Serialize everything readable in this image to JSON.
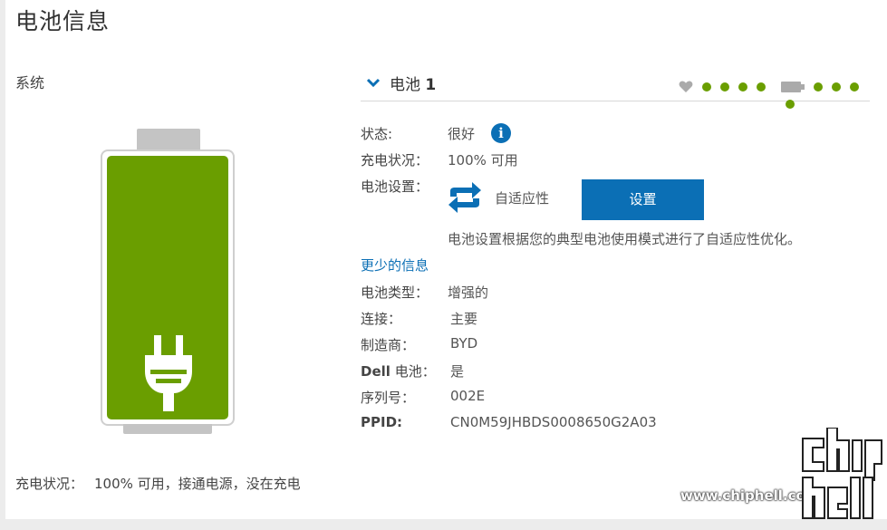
{
  "page": {
    "title": "电池信息"
  },
  "system": {
    "label": "系统"
  },
  "footer": {
    "charge_label": "充电状况：",
    "charge_value": "100% 可用，接通电源，没在充电"
  },
  "battery": {
    "name": "电池",
    "number": "1",
    "health_dots": 4,
    "charge_dots": 4,
    "accent": "#6a9e00"
  },
  "details": {
    "status_label": "状态:",
    "status_value": "很好",
    "charge_label": "充电状况：",
    "charge_value": "100% 可用",
    "setting_label": "电池设置：",
    "setting_mode": "自适应性",
    "setting_button": "设置",
    "setting_desc": "电池设置根据您的典型电池使用模式进行了自适应性优化。",
    "less_info": "更少的信息",
    "type_label": "电池类型：",
    "type_value": "增强的",
    "connect_label": "连接：",
    "connect_value": "主要",
    "maker_label": "制造商：",
    "maker_value": "BYD",
    "dell_label_bold": "Dell",
    "dell_label_rest": " 电池：",
    "dell_value": "是",
    "serial_label": "序列号：",
    "serial_value": "002E",
    "ppid_label": "PPID:",
    "ppid_value": "CN0M59JHBDS0008650G2A03"
  },
  "watermark": {
    "url": "www.chiphell.com"
  },
  "colors": {
    "brand_blue": "#0b6fb5",
    "battery_green": "#6a9e00"
  }
}
